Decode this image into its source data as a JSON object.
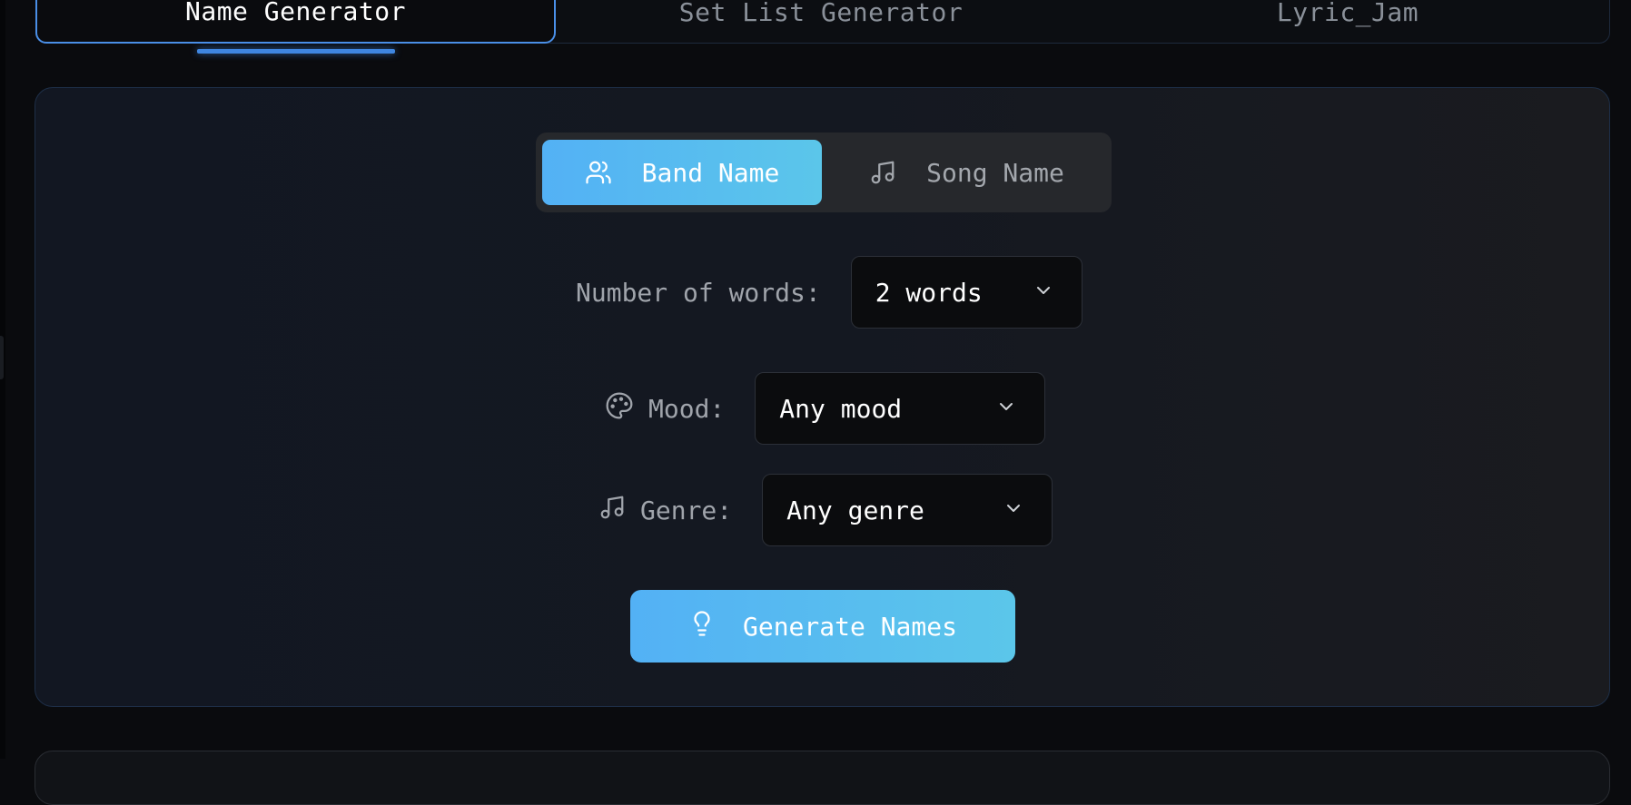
{
  "tabs": [
    {
      "label": "Name Generator",
      "active": true
    },
    {
      "label": "Set List Generator",
      "active": false
    },
    {
      "label": "Lyric_Jam",
      "active": false
    }
  ],
  "mode_toggle": {
    "band_label": "Band Name",
    "band_icon": "users-icon",
    "song_label": "Song Name",
    "song_icon": "music-note-icon",
    "selected": "Band Name"
  },
  "form": {
    "words": {
      "label": "Number of words:",
      "value": "2 words"
    },
    "mood": {
      "label": "Mood:",
      "value": "Any mood",
      "icon": "palette-icon"
    },
    "genre": {
      "label": "Genre:",
      "value": "Any genre",
      "icon": "music-note-icon"
    }
  },
  "generate_button": {
    "label": "Generate Names",
    "icon": "lightbulb-icon"
  },
  "colors": {
    "accent_gradient_start": "#53b1f5",
    "accent_gradient_end": "#5bc6ea",
    "active_tab_border": "#4a8fe7",
    "background": "#0a0b0e",
    "card_background": "#141821"
  }
}
